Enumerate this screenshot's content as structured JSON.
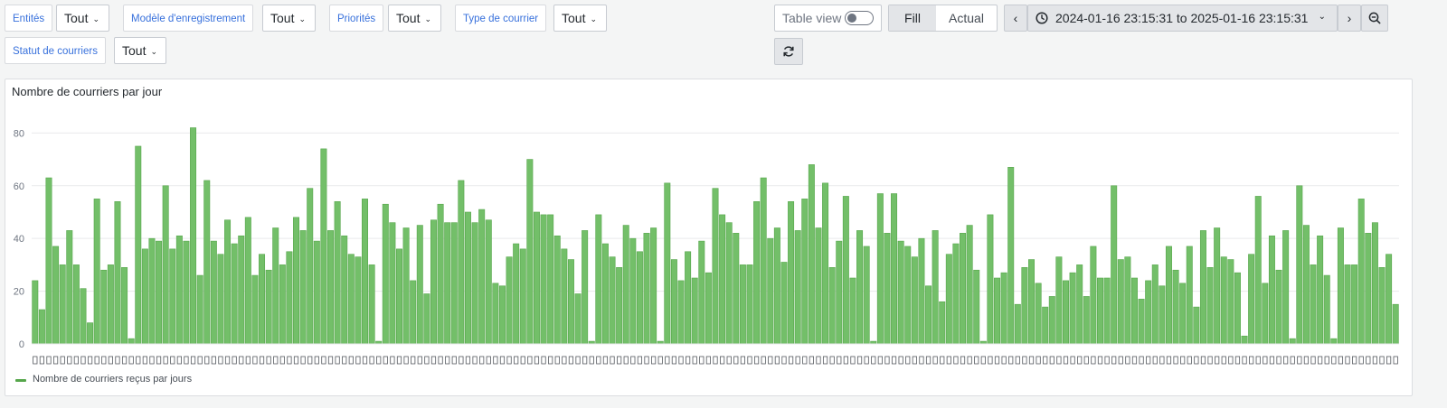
{
  "filters": [
    {
      "label": "Entités",
      "value": "Tout"
    },
    {
      "label": "Modèle d'enregistrement",
      "value": "Tout"
    },
    {
      "label": "Priorités",
      "value": "Tout"
    },
    {
      "label": "Type de courrier",
      "value": "Tout"
    },
    {
      "label": "Statut de courriers",
      "value": "Tout"
    }
  ],
  "toolbar": {
    "table_view_label": "Table view",
    "table_view_on": false,
    "fill_label": "Fill",
    "actual_label": "Actual",
    "time_range": "2024-01-16 23:15:31 to 2025-01-16 23:15:31"
  },
  "panel": {
    "title": "Nombre de courriers par jour"
  },
  "chart_data": {
    "type": "bar",
    "title": "Nombre de courriers par jour",
    "xlabel": "",
    "ylabel": "",
    "ylim": [
      0,
      88
    ],
    "yticks": [
      0,
      20,
      40,
      60,
      80
    ],
    "grid": true,
    "legend_position": "bottom-left",
    "color": "#73bf69",
    "edge_color": "#56a64b",
    "series": [
      {
        "name": "Nombre de courriers reçus par jours",
        "values": [
          24,
          13,
          63,
          37,
          30,
          43,
          30,
          21,
          8,
          55,
          28,
          30,
          54,
          29,
          2,
          75,
          36,
          40,
          39,
          60,
          36,
          41,
          39,
          82,
          26,
          62,
          39,
          34,
          47,
          38,
          41,
          48,
          26,
          34,
          28,
          44,
          30,
          35,
          48,
          43,
          59,
          39,
          74,
          43,
          54,
          41,
          34,
          33,
          55,
          30,
          1,
          53,
          46,
          36,
          44,
          24,
          45,
          19,
          47,
          53,
          46,
          46,
          62,
          50,
          46,
          51,
          47,
          23,
          22,
          33,
          38,
          36,
          70,
          50,
          49,
          49,
          41,
          36,
          32,
          19,
          43,
          1,
          49,
          38,
          33,
          29,
          45,
          40,
          35,
          42,
          44,
          1,
          61,
          32,
          24,
          35,
          25,
          39,
          27,
          59,
          49,
          46,
          42,
          30,
          30,
          54,
          63,
          40,
          44,
          31,
          54,
          43,
          55,
          68,
          44,
          61,
          29,
          39,
          56,
          25,
          43,
          37,
          1,
          57,
          42,
          57,
          39,
          37,
          33,
          40,
          22,
          43,
          16,
          34,
          38,
          42,
          45,
          28,
          1,
          49,
          25,
          27,
          67,
          15,
          29,
          32,
          23,
          14,
          18,
          33,
          24,
          27,
          30,
          18,
          37,
          25,
          25,
          60,
          32,
          33,
          25,
          17,
          24,
          30,
          22,
          37,
          28,
          23,
          37,
          14,
          43,
          29,
          44,
          33,
          32,
          27,
          3,
          34,
          56,
          23,
          41,
          28,
          43,
          2,
          60,
          45,
          30,
          41,
          26,
          2,
          44,
          30,
          30,
          55,
          42,
          46,
          29,
          34,
          15
        ]
      }
    ]
  }
}
